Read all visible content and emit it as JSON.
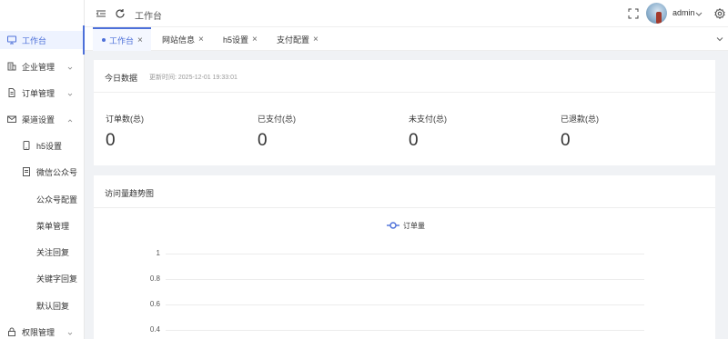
{
  "header": {
    "breadcrumb": "工作台",
    "username": "admin"
  },
  "sidebar": {
    "items": [
      {
        "label": "工作台",
        "icon": "monitor-icon",
        "active": true
      },
      {
        "label": "企业管理",
        "icon": "building-icon"
      },
      {
        "label": "订单管理",
        "icon": "document-icon"
      },
      {
        "label": "渠道设置",
        "icon": "mail-icon"
      },
      {
        "label": "h5设置",
        "icon": "phone-icon"
      },
      {
        "label": "微信公众号",
        "icon": "file-icon"
      },
      {
        "label": "公众号配置"
      },
      {
        "label": "菜单管理"
      },
      {
        "label": "关注回复"
      },
      {
        "label": "关键字回复"
      },
      {
        "label": "默认回复"
      },
      {
        "label": "权限管理",
        "icon": "lock-icon"
      }
    ]
  },
  "tabs": [
    {
      "label": "工作台",
      "active": true
    },
    {
      "label": "网站信息"
    },
    {
      "label": "h5设置"
    },
    {
      "label": "支付配置"
    }
  ],
  "today": {
    "title": "今日数据",
    "updated": "更新时间: 2025-12-01 19:33:01",
    "stats": [
      {
        "label": "订单数(总)",
        "value": "0"
      },
      {
        "label": "已支付(总)",
        "value": "0"
      },
      {
        "label": "未支付(总)",
        "value": "0"
      },
      {
        "label": "已退款(总)",
        "value": "0"
      }
    ]
  },
  "trend": {
    "title": "访问量趋势图"
  },
  "chart_data": {
    "type": "line",
    "title": "",
    "series": [
      {
        "name": "订单量",
        "values": []
      }
    ],
    "yticks": [
      "1",
      "0.8",
      "0.6",
      "0.4"
    ],
    "ylim": [
      0,
      1
    ],
    "grid": true,
    "legend_position": "top-center",
    "color": "#4d70d9"
  }
}
